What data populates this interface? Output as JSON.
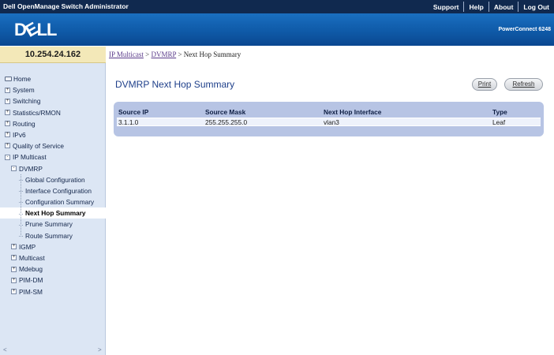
{
  "topbar": {
    "title": "Dell OpenManage Switch Administrator",
    "links": [
      "Support",
      "Help",
      "About",
      "Log Out"
    ]
  },
  "brand": {
    "logo": "DELL",
    "model": "PowerConnect 6248"
  },
  "ip": "10.254.24.162",
  "breadcrumb": {
    "level1": "IP Multicast",
    "level2": "DVMRP",
    "current": "Next Hop Summary",
    "separator": ">"
  },
  "page": {
    "title": "DVMRP Next Hop Summary",
    "print_label": "Print",
    "refresh_label": "Refresh"
  },
  "sidebar": {
    "items": [
      {
        "label": "Home",
        "icon": "home-icon",
        "indent": 0,
        "toggle": ""
      },
      {
        "label": "System",
        "icon": "",
        "indent": 0,
        "toggle": "+"
      },
      {
        "label": "Switching",
        "icon": "",
        "indent": 0,
        "toggle": "+"
      },
      {
        "label": "Statistics/RMON",
        "icon": "",
        "indent": 0,
        "toggle": "+"
      },
      {
        "label": "Routing",
        "icon": "",
        "indent": 0,
        "toggle": "+"
      },
      {
        "label": "IPv6",
        "icon": "",
        "indent": 0,
        "toggle": "+"
      },
      {
        "label": "Quality of Service",
        "icon": "",
        "indent": 0,
        "toggle": "+"
      },
      {
        "label": "IP Multicast",
        "icon": "",
        "indent": 0,
        "toggle": "-"
      },
      {
        "label": "DVMRP",
        "icon": "",
        "indent": 1,
        "toggle": "-"
      },
      {
        "label": "Global Configuration",
        "icon": "",
        "indent": 2,
        "toggle": ""
      },
      {
        "label": "Interface Configuration",
        "icon": "",
        "indent": 2,
        "toggle": ""
      },
      {
        "label": "Configuration Summary",
        "icon": "",
        "indent": 2,
        "toggle": ""
      },
      {
        "label": "Next Hop Summary",
        "icon": "",
        "indent": 2,
        "toggle": "",
        "selected": true
      },
      {
        "label": "Prune Summary",
        "icon": "",
        "indent": 2,
        "toggle": ""
      },
      {
        "label": "Route Summary",
        "icon": "",
        "indent": 2,
        "toggle": ""
      },
      {
        "label": "IGMP",
        "icon": "",
        "indent": 1,
        "toggle": "+"
      },
      {
        "label": "Multicast",
        "icon": "",
        "indent": 1,
        "toggle": "+"
      },
      {
        "label": "Mdebug",
        "icon": "",
        "indent": 1,
        "toggle": "+"
      },
      {
        "label": "PIM-DM",
        "icon": "",
        "indent": 1,
        "toggle": "+"
      },
      {
        "label": "PIM-SM",
        "icon": "",
        "indent": 1,
        "toggle": "+"
      }
    ]
  },
  "table": {
    "headers": [
      "Source IP",
      "Source Mask",
      "Next Hop Interface",
      "Type"
    ],
    "rows": [
      [
        "3.1.1.0",
        "255.255.255.0",
        "vlan3",
        "Leaf"
      ]
    ]
  }
}
